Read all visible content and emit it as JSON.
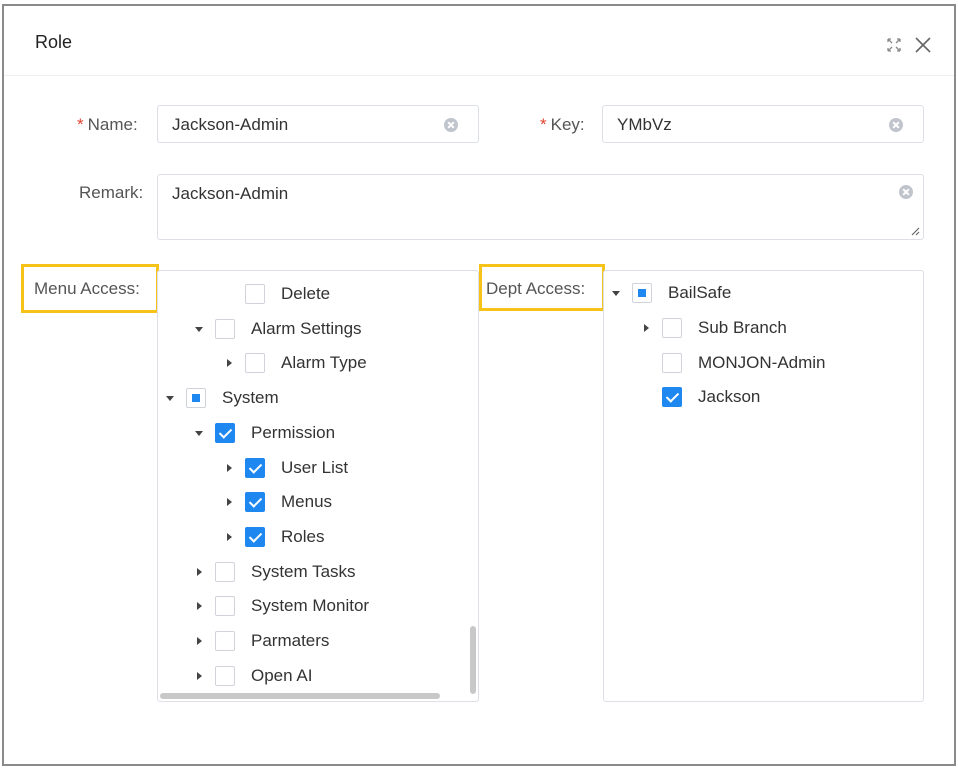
{
  "dialog": {
    "title": "Role"
  },
  "form": {
    "name": {
      "label": "Name:",
      "value": "Jackson-Admin",
      "required_mark": "*"
    },
    "key": {
      "label": "Key:",
      "value": "YMbVz",
      "required_mark": "*"
    },
    "remark": {
      "label": "Remark:",
      "value": "Jackson-Admin"
    },
    "menu_access_label": "Menu Access:",
    "dept_access_label": "Dept Access:"
  },
  "menu_tree": [
    {
      "label": "Delete",
      "state": "unchecked",
      "arrow": "none"
    },
    {
      "label": "Alarm Settings",
      "state": "unchecked",
      "arrow": "down"
    },
    {
      "label": "Alarm Type",
      "state": "unchecked",
      "arrow": "right"
    },
    {
      "label": "System",
      "state": "indeterminate",
      "arrow": "down"
    },
    {
      "label": "Permission",
      "state": "checked",
      "arrow": "down"
    },
    {
      "label": "User List",
      "state": "checked",
      "arrow": "right"
    },
    {
      "label": "Menus",
      "state": "checked",
      "arrow": "right"
    },
    {
      "label": "Roles",
      "state": "checked",
      "arrow": "right"
    },
    {
      "label": "System Tasks",
      "state": "unchecked",
      "arrow": "right"
    },
    {
      "label": "System Monitor",
      "state": "unchecked",
      "arrow": "right"
    },
    {
      "label": "Parmaters",
      "state": "unchecked",
      "arrow": "right"
    },
    {
      "label": "Open AI",
      "state": "unchecked",
      "arrow": "right"
    }
  ],
  "dept_tree": [
    {
      "label": "BailSafe",
      "state": "indeterminate",
      "arrow": "down"
    },
    {
      "label": "Sub Branch",
      "state": "unchecked",
      "arrow": "right"
    },
    {
      "label": "MONJON-Admin",
      "state": "unchecked",
      "arrow": "none"
    },
    {
      "label": "Jackson",
      "state": "checked",
      "arrow": "none"
    }
  ],
  "colors": {
    "accent": "#1e88f0",
    "highlight": "#f6c31a",
    "required": "#e0432f"
  },
  "icons": {
    "fullscreen": "fullscreen-icon",
    "close": "close-icon",
    "clear": "clear-icon"
  }
}
